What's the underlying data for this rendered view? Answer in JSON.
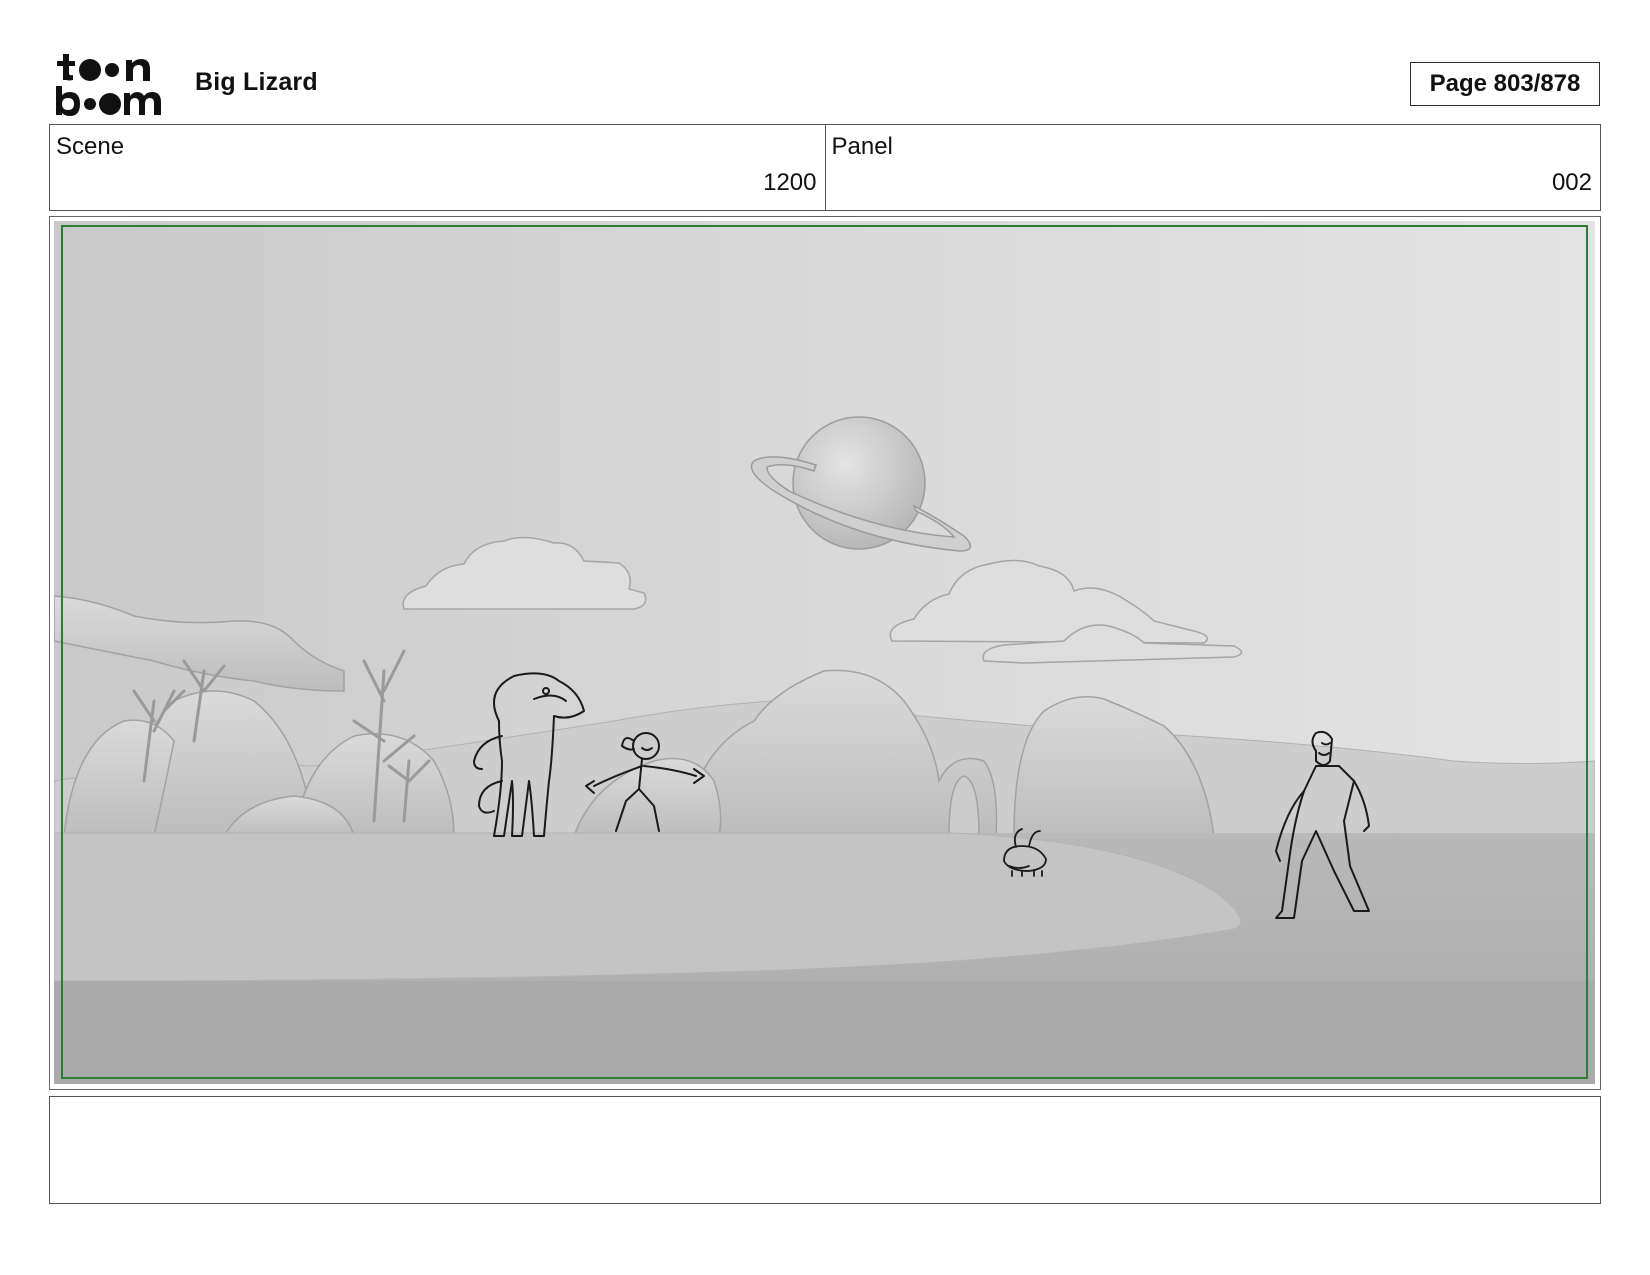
{
  "header": {
    "logo_text": "toon boom",
    "project_title": "Big Lizard",
    "page_label": "Page 803/878"
  },
  "info": {
    "scene_label": "Scene",
    "scene_value": "1200",
    "panel_label": "Panel",
    "panel_value": "002"
  },
  "panel": {
    "image_icon": "storyboard-panel-image",
    "safe_frame_color": "#2e7d32"
  },
  "caption": {
    "text": ""
  }
}
